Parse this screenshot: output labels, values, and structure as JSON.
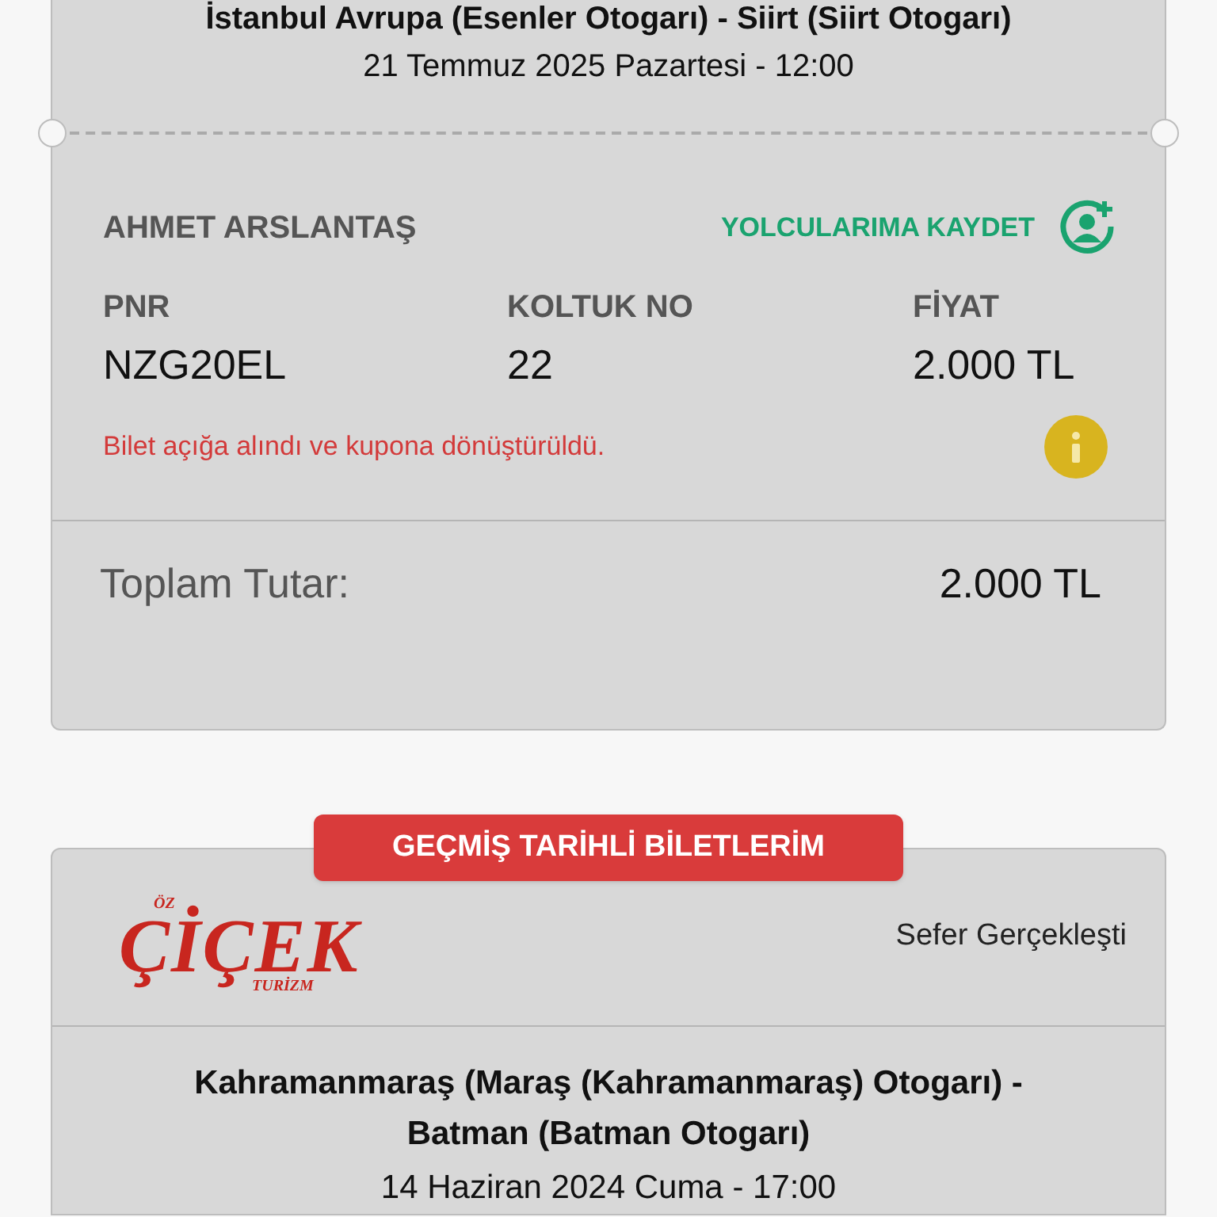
{
  "current_ticket": {
    "route": "İstanbul Avrupa (Esenler Otogarı) - Siirt (Siirt Otogarı)",
    "date": "21 Temmuz 2025 Pazartesi - 12:00",
    "passenger": {
      "name": "AHMET ARSLANTAŞ",
      "save_action": "YOLCULARIMA KAYDET",
      "fields": [
        {
          "label": "PNR",
          "value": "NZG20EL"
        },
        {
          "label": "KOLTUK NO",
          "value": "22"
        },
        {
          "label": "FİYAT",
          "value": "2.000 TL"
        }
      ],
      "notice": "Bilet açığa alındı ve kupona dönüştürüldü."
    },
    "total_label": "Toplam Tutar:",
    "total_value": "2.000 TL"
  },
  "past_section": {
    "title": "GEÇMİŞ TARİHLİ BİLETLERİM",
    "ticket": {
      "logo": {
        "top": "ÖZ",
        "main": "ÇİÇEK",
        "bottom": "TURİZM"
      },
      "status": "Sefer Gerçekleşti",
      "route_lines": [
        "Kahramanmaraş (Maraş (Kahramanmaraş) Otogarı) -",
        "Batman (Batman Otogarı)"
      ],
      "date": "14 Haziran 2024 Cuma - 17:00"
    }
  }
}
